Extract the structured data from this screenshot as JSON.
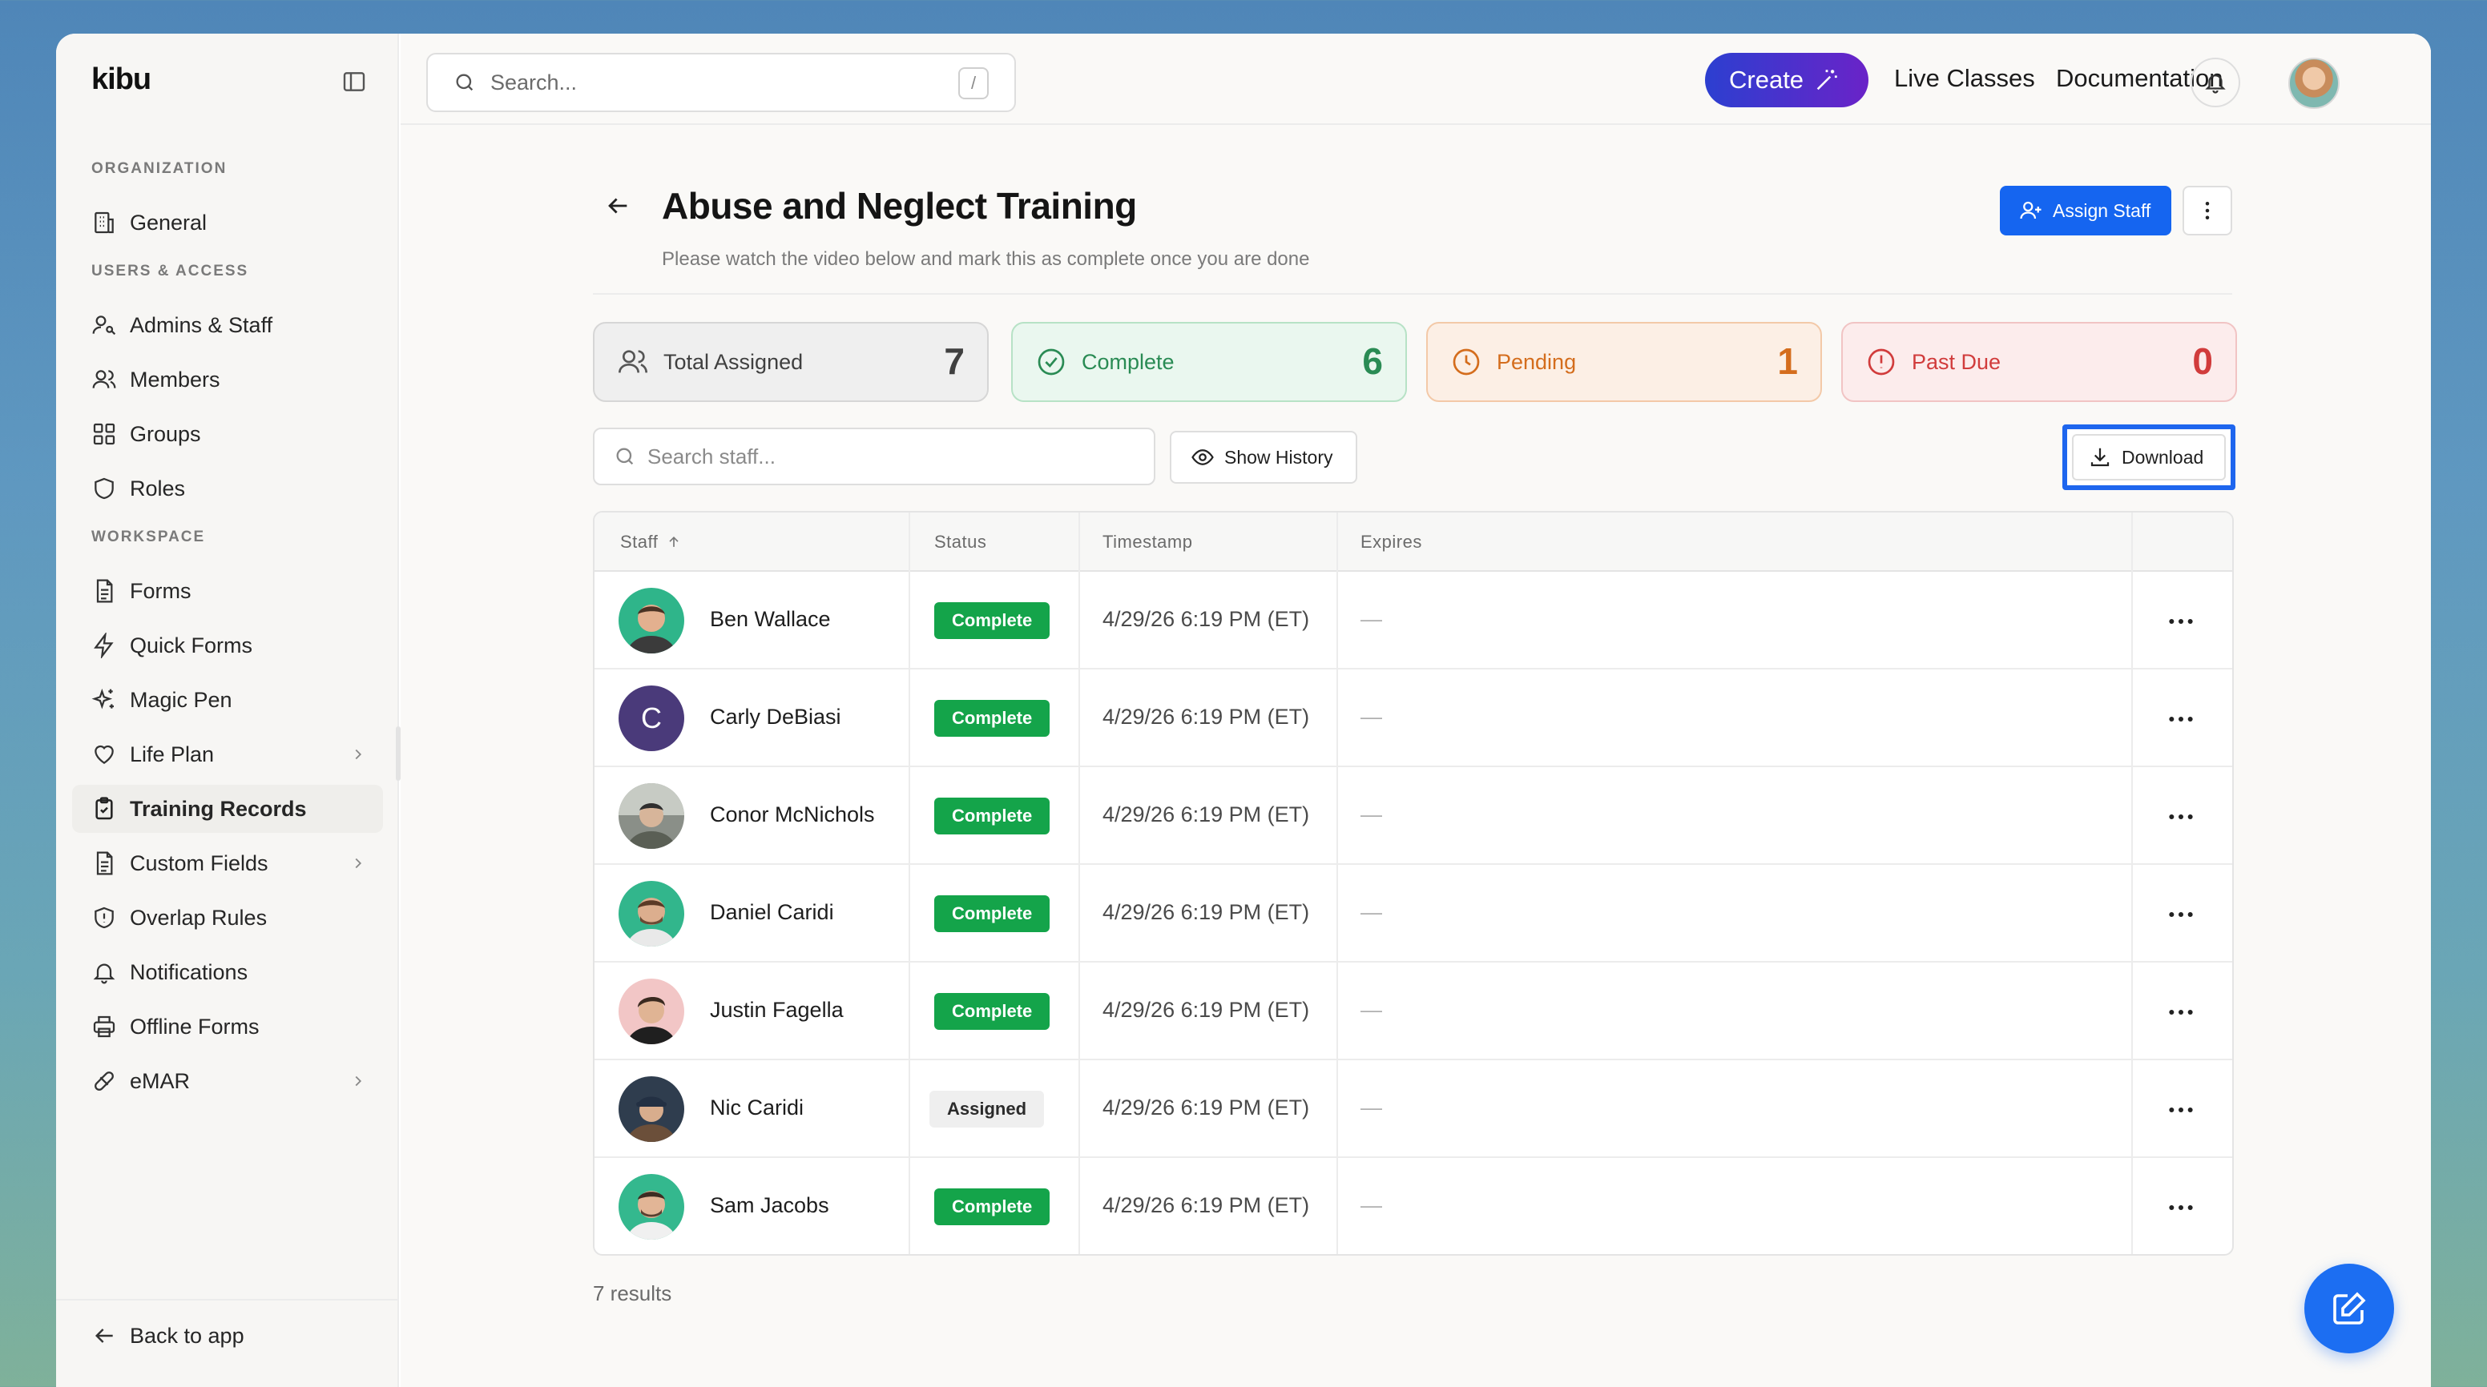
{
  "app": {
    "logo": "kibu"
  },
  "topbar": {
    "search_placeholder": "Search...",
    "search_shortcut": "/",
    "create_label": "Create",
    "links": [
      "Live Classes",
      "Documentation"
    ]
  },
  "sidebar": {
    "sections": {
      "organization": "ORGANIZATION",
      "users_access": "USERS & ACCESS",
      "workspace": "WORKSPACE"
    },
    "items": [
      {
        "label": "General",
        "icon": "building-icon"
      },
      {
        "label": "Admins & Staff",
        "icon": "user-key-icon"
      },
      {
        "label": "Members",
        "icon": "users-icon"
      },
      {
        "label": "Groups",
        "icon": "grid-icon"
      },
      {
        "label": "Roles",
        "icon": "shield-icon"
      },
      {
        "label": "Forms",
        "icon": "document-icon"
      },
      {
        "label": "Quick Forms",
        "icon": "lightning-icon"
      },
      {
        "label": "Magic Pen",
        "icon": "sparkles-icon"
      },
      {
        "label": "Life Plan",
        "icon": "heart-icon"
      },
      {
        "label": "Training Records",
        "icon": "clipboard-check-icon"
      },
      {
        "label": "Custom Fields",
        "icon": "document-icon"
      },
      {
        "label": "Overlap Rules",
        "icon": "shield-alert-icon"
      },
      {
        "label": "Notifications",
        "icon": "bell-icon"
      },
      {
        "label": "Offline Forms",
        "icon": "printer-icon"
      },
      {
        "label": "eMAR",
        "icon": "pill-icon"
      }
    ],
    "back_label": "Back to app"
  },
  "page": {
    "title": "Abuse and Neglect Training",
    "subtitle": "Please watch the video below and mark this as complete once you are done",
    "assign_label": "Assign Staff"
  },
  "stats": {
    "total": {
      "label": "Total Assigned",
      "value": "7"
    },
    "complete": {
      "label": "Complete",
      "value": "6"
    },
    "pending": {
      "label": "Pending",
      "value": "1"
    },
    "past_due": {
      "label": "Past Due",
      "value": "0"
    }
  },
  "toolbar": {
    "search_placeholder": "Search staff...",
    "history_label": "Show History",
    "download_label": "Download"
  },
  "table": {
    "headers": {
      "staff": "Staff",
      "status": "Status",
      "timestamp": "Timestamp",
      "expires": "Expires"
    },
    "rows": [
      {
        "name": "Ben Wallace",
        "status": "Complete",
        "timestamp": "4/29/26 6:19 PM (ET)",
        "expires": "—"
      },
      {
        "name": "Carly DeBiasi",
        "status": "Complete",
        "timestamp": "4/29/26 6:19 PM (ET)",
        "expires": "—",
        "initial": "C"
      },
      {
        "name": "Conor McNichols",
        "status": "Complete",
        "timestamp": "4/29/26 6:19 PM (ET)",
        "expires": "—"
      },
      {
        "name": "Daniel Caridi",
        "status": "Complete",
        "timestamp": "4/29/26 6:19 PM (ET)",
        "expires": "—"
      },
      {
        "name": "Justin Fagella",
        "status": "Complete",
        "timestamp": "4/29/26 6:19 PM (ET)",
        "expires": "—"
      },
      {
        "name": "Nic Caridi",
        "status": "Assigned",
        "timestamp": "4/29/26 6:19 PM (ET)",
        "expires": "—"
      },
      {
        "name": "Sam Jacobs",
        "status": "Complete",
        "timestamp": "4/29/26 6:19 PM (ET)",
        "expires": "—"
      }
    ]
  },
  "results_label": "7 results",
  "colors": {
    "primary": "#1565f0",
    "complete": "#14a44a",
    "pending": "#d46d1d",
    "past_due": "#d13c3c"
  }
}
